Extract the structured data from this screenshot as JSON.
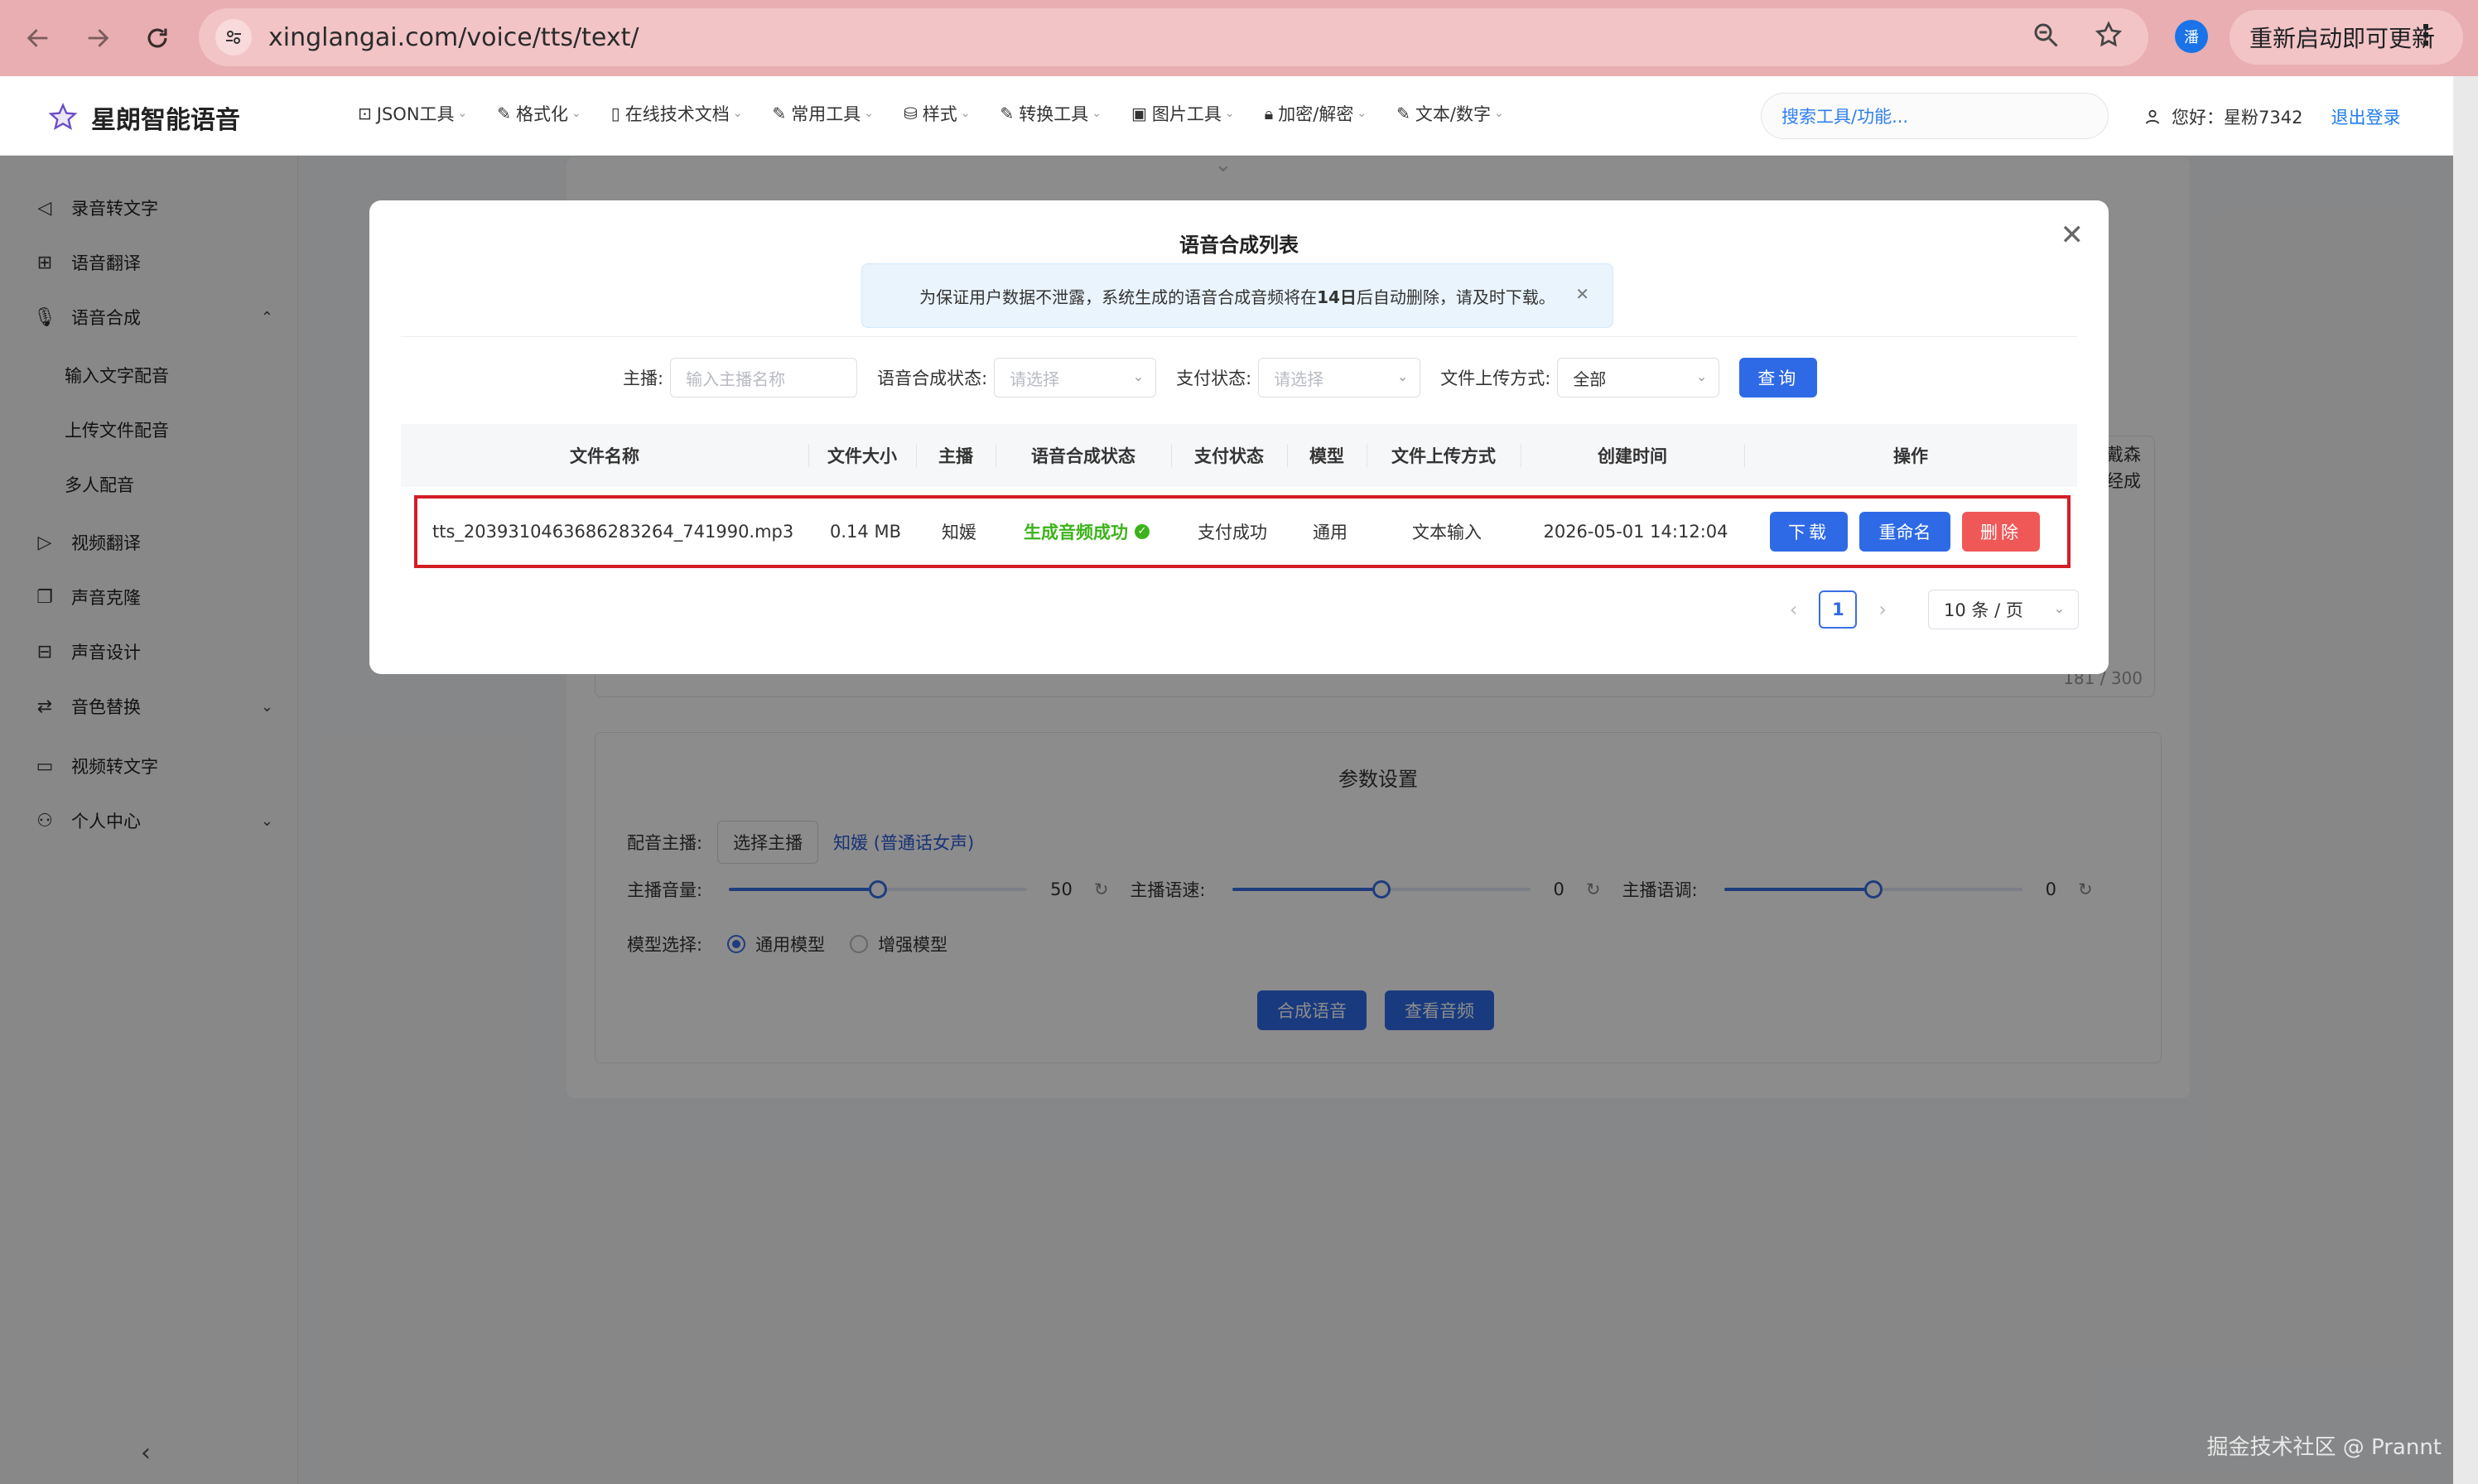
{
  "browser": {
    "url": "xinglangai.com/voice/tts/text/",
    "profile_initial": "潘",
    "update_label": "重新启动即可更新"
  },
  "header": {
    "app_name": "星朗智能语音",
    "menu": [
      {
        "label": "JSON工具"
      },
      {
        "label": "格式化"
      },
      {
        "label": "在线技术文档"
      },
      {
        "label": "常用工具"
      },
      {
        "label": "样式"
      },
      {
        "label": "转换工具"
      },
      {
        "label": "图片工具"
      },
      {
        "label": "加密/解密"
      },
      {
        "label": "文本/数字"
      }
    ],
    "search_placeholder": "搜索工具/功能...",
    "greeting": "您好：星粉7342",
    "logout": "退出登录"
  },
  "sidebar": {
    "items": [
      {
        "label": "录音转文字",
        "icon": "speaker-icon"
      },
      {
        "label": "语音翻译",
        "icon": "translate-icon"
      },
      {
        "label": "语音合成",
        "icon": "mic-icon"
      },
      {
        "label": "视频翻译",
        "icon": "play-icon"
      },
      {
        "label": "声音克隆",
        "icon": "copy-icon"
      },
      {
        "label": "声音设计",
        "icon": "equalizer-icon"
      },
      {
        "label": "音色替换",
        "icon": "swap-icon"
      },
      {
        "label": "视频转文字",
        "icon": "video-icon"
      },
      {
        "label": "个人中心",
        "icon": "user-icon"
      }
    ],
    "sub_items": [
      "输入文字配音",
      "上传文件配音",
      "多人配音"
    ]
  },
  "background": {
    "textarea_peek": "戴森\n经成",
    "textarea_counter": "181 / 300",
    "param_title": "参数设置",
    "voice_label": "配音主播:",
    "choose_voice_btn": "选择主播",
    "selected_voice": "知媛 (普通话女声)",
    "volume_label": "主播音量:",
    "volume_value": "50",
    "speed_label": "主播语速:",
    "speed_value": "0",
    "pitch_label": "主播语调:",
    "pitch_value": "0",
    "model_label": "模型选择:",
    "model_general": "通用模型",
    "model_enhanced": "增强模型",
    "synth_btn": "合成语音",
    "view_audio_btn": "查看音频"
  },
  "modal": {
    "title": "语音合成列表",
    "notice_pre": "为保证用户数据不泄露，系统生成的语音合成音频将在",
    "notice_bold": "14日",
    "notice_post": "后自动删除，请及时下载。",
    "filters": {
      "anchor_label": "主播:",
      "anchor_placeholder": "输入主播名称",
      "status_label": "语音合成状态:",
      "status_placeholder": "请选择",
      "pay_label": "支付状态:",
      "pay_placeholder": "请选择",
      "upload_label": "文件上传方式:",
      "upload_value": "全部",
      "query_btn": "查询"
    },
    "columns": [
      "文件名称",
      "文件大小",
      "主播",
      "语音合成状态",
      "支付状态",
      "模型",
      "文件上传方式",
      "创建时间",
      "操作"
    ],
    "rows": [
      {
        "file_name": "tts_2039310463686283264_741990.mp3",
        "size": "0.14 MB",
        "anchor": "知媛",
        "synth_status": "生成音频成功",
        "pay_status": "支付成功",
        "model": "通用",
        "upload_method": "文本输入",
        "created": "2026-05-01 14:12:04",
        "actions": {
          "download": "下载",
          "rename": "重命名",
          "delete": "删除"
        }
      }
    ],
    "pager": {
      "page": "1",
      "page_size": "10 条 / 页"
    }
  },
  "watermark": "掘金技术社区 @ Prannt",
  "colors": {
    "primary": "#2f6ae6",
    "danger": "#f05858",
    "success": "#3cb31a",
    "highlight_border": "#d31e26",
    "browser_bar": "#e8aeb1"
  }
}
